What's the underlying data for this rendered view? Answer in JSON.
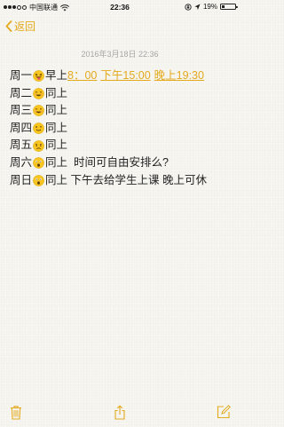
{
  "status_bar": {
    "carrier": "中国联通",
    "time": "22:36",
    "battery": "19%",
    "battery_level": 0.19
  },
  "nav": {
    "back_label": "返回"
  },
  "note": {
    "date": "2016年3月18日 22:36",
    "lines": [
      {
        "day": "周一",
        "emoji": "grinning-tongue",
        "text": "早上",
        "links": [
          "8：00",
          "下午15:00",
          "晚上19:30"
        ]
      },
      {
        "day": "周二",
        "emoji": "smile",
        "text": "同上"
      },
      {
        "day": "周三",
        "emoji": "smile",
        "text": "同上"
      },
      {
        "day": "周四",
        "emoji": "wink",
        "text": "同上"
      },
      {
        "day": "周五",
        "emoji": "disappointed",
        "text": "同上"
      },
      {
        "day": "周六",
        "emoji": "astonished",
        "text": "同上  时间可自由安排么?"
      },
      {
        "day": "周日",
        "emoji": "astonished",
        "text": "同上 下午去给学生上课 晚上可休"
      }
    ]
  },
  "colors": {
    "accent": "#e4a91d",
    "background": "#f7f6f1",
    "date_text": "#a6a6a6"
  },
  "toolbar": {
    "icons": [
      "trash-icon",
      "share-icon",
      "compose-icon"
    ]
  }
}
